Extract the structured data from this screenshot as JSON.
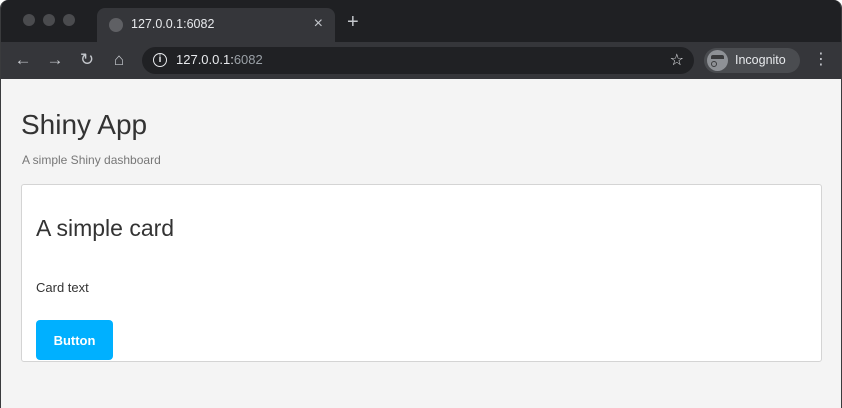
{
  "browser": {
    "tab": {
      "title": "127.0.0.1:6082",
      "close_glyph": "×"
    },
    "new_tab_glyph": "+",
    "nav": {
      "back_glyph": "←",
      "forward_glyph": "→",
      "reload_glyph": "↻",
      "home_glyph": "⌂"
    },
    "address": {
      "host": "127.0.0.1:",
      "port": "6082",
      "info_glyph": "i"
    },
    "star_glyph": "☆",
    "incognito_label": "Incognito",
    "menu_glyph": "⋮"
  },
  "app": {
    "title": "Shiny App",
    "subtitle": "A simple Shiny dashboard"
  },
  "card": {
    "title": "A simple card",
    "text": "Card text",
    "button_label": "Button"
  },
  "colors": {
    "button_accent": "#00b0ff",
    "page_background": "#f4f4f4"
  }
}
